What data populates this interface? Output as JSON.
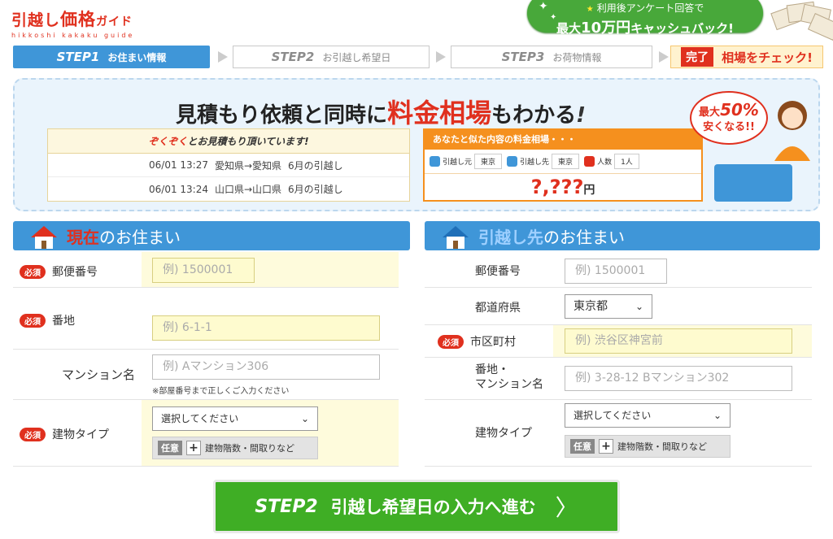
{
  "logo": {
    "main_1": "引越し",
    "main_2": "価格",
    "main_3": "ガイド",
    "sub": "hikkoshi kakaku guide"
  },
  "cashback": {
    "line1_prefix": "★",
    "line1": "利用後アンケート回答で",
    "line2_prefix": "最大",
    "line2_amount": "10万円",
    "line2_suffix": "キャッシュバック!"
  },
  "steps": [
    {
      "num": "STEP1",
      "label": "お住まい情報"
    },
    {
      "num": "STEP2",
      "label": "お引越し希望日"
    },
    {
      "num": "STEP3",
      "label": "お荷物情報"
    },
    {
      "num": "完了",
      "label": "相場をチェック!"
    }
  ],
  "banner": {
    "title_pre": "見積もり依頼と同時に",
    "title_hl": "料金相場",
    "title_post": "もわかる",
    "title_mark": "!",
    "recent_head_red": "ぞくぞく",
    "recent_head": "とお見積もり頂いています!",
    "recent": [
      {
        "time": "06/01 13:27",
        "route": "愛知県→愛知県",
        "month": "6月の引越し"
      },
      {
        "time": "06/01 13:24",
        "route": "山口県→山口県",
        "month": "6月の引越し"
      }
    ],
    "price_head": "あなたと似た内容の料金相場・・・",
    "chips": [
      {
        "label": "引越し元",
        "value": "東京"
      },
      {
        "label": "引越し先",
        "value": "東京"
      },
      {
        "label": "人数",
        "value": "1人"
      }
    ],
    "price": "?,???",
    "price_unit": "円",
    "bubble_1": "最大",
    "bubble_pct": "50%",
    "bubble_2": "安くなる!!"
  },
  "current": {
    "title_red": "現在",
    "title": "のお住まい",
    "req": "必須",
    "postal_label": "郵便番号",
    "postal_ph": "例) 1500001",
    "address_label": "番地",
    "address_ph": "例) 6-1-1",
    "mansion_label": "マンション名",
    "mansion_ph": "例) Aマンション306",
    "mansion_note": "※部屋番号まで正しくご入力ください",
    "building_label": "建物タイプ",
    "building_sel": "選択してください",
    "opt_tag": "任意",
    "opt_text": "建物階数・間取りなど"
  },
  "dest": {
    "title_blue": "引越し先",
    "title": "のお住まい",
    "postal_label": "郵便番号",
    "postal_ph": "例) 1500001",
    "pref_label": "都道府県",
    "pref_val": "東京都",
    "city_label": "市区町村",
    "city_ph": "例) 渋谷区神宮前",
    "addr_label_1": "番地・",
    "addr_label_2": "マンション名",
    "addr_ph": "例) 3-28-12 Bマンション302",
    "building_label": "建物タイプ",
    "building_sel": "選択してください",
    "opt_tag": "任意",
    "opt_text": "建物階数・間取りなど"
  },
  "cta": {
    "step": "STEP2",
    "label": "引越し希望日の入力へ進む",
    "chev": "〉"
  }
}
